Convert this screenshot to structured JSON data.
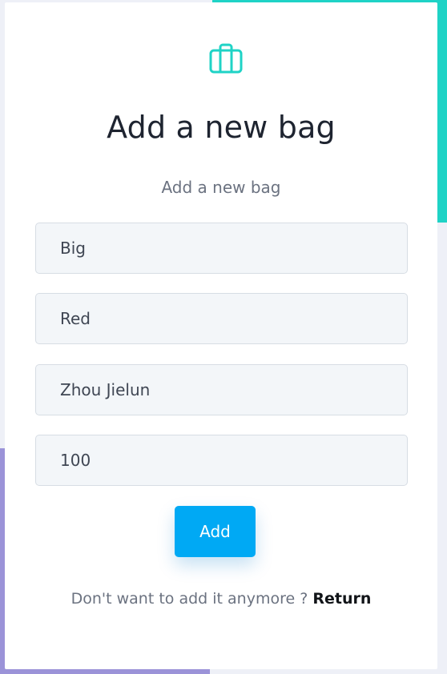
{
  "colors": {
    "accent_teal": "#1fd3c6",
    "accent_purple": "#9b93d8",
    "button_blue": "#00a9f4",
    "icon_color": "#1fd3c6"
  },
  "header": {
    "icon": "briefcase-icon",
    "title": "Add a new bag",
    "subtitle": "Add a new bag"
  },
  "form": {
    "fields": [
      {
        "value": "Big"
      },
      {
        "value": "Red"
      },
      {
        "value": "Zhou Jielun"
      },
      {
        "value": "100"
      }
    ],
    "submit_label": "Add"
  },
  "footer": {
    "prompt": "Don't want to add it anymore ?",
    "link_label": "Return"
  }
}
